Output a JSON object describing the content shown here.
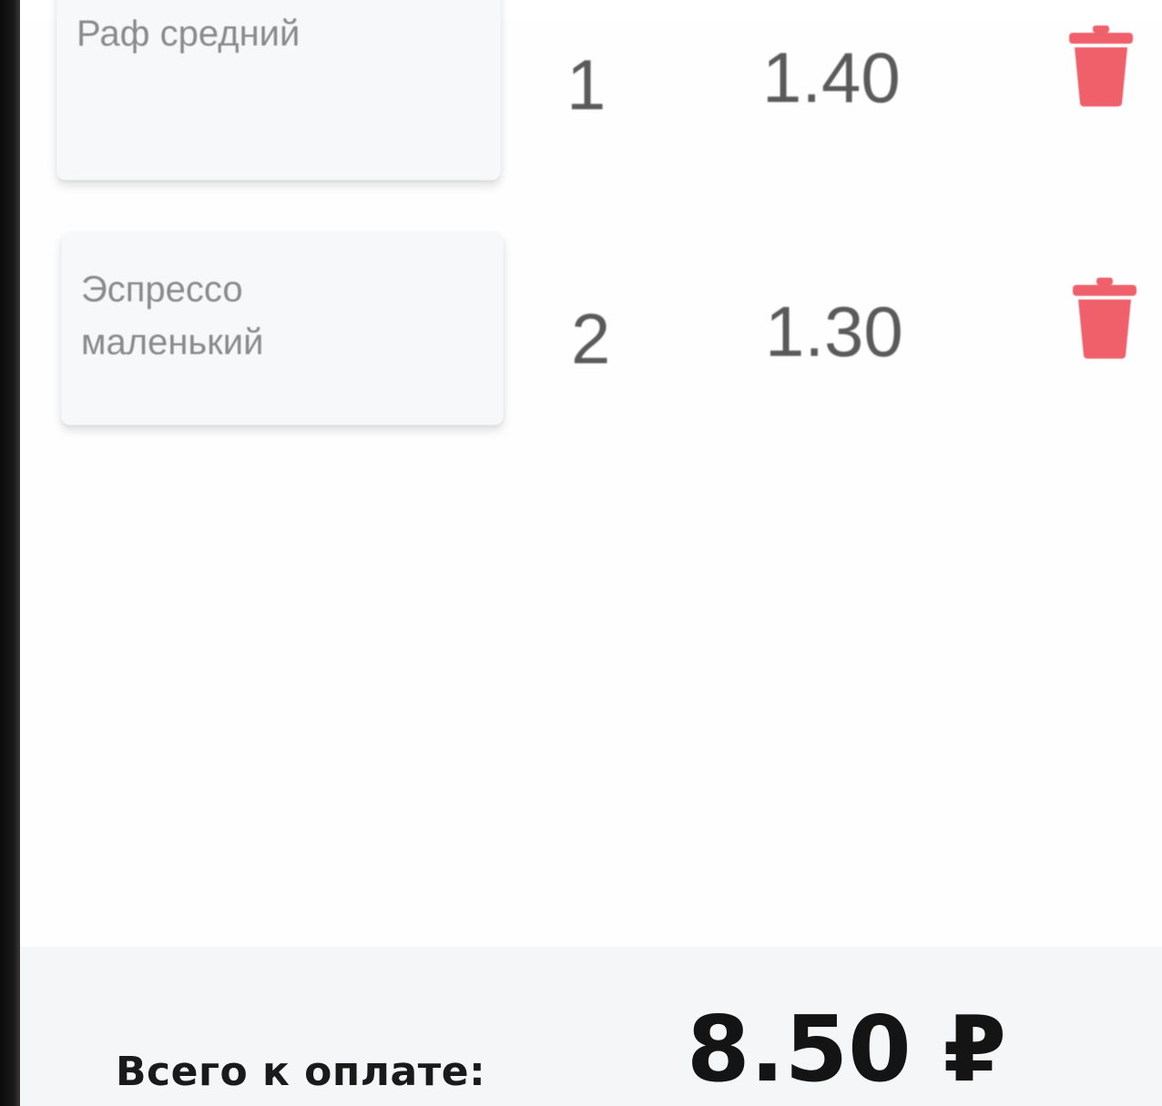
{
  "cart": {
    "items": [
      {
        "name": "Раф средний",
        "quantity": "1",
        "price": "1.40"
      },
      {
        "name": "Эспрессо маленький",
        "quantity": "2",
        "price": "1.30"
      }
    ]
  },
  "footer": {
    "total_label": "Всего к оплате:",
    "total_value": "8.50 ₽"
  },
  "icons": {
    "delete": "trash-icon"
  },
  "colors": {
    "delete_accent": "#f0606a",
    "card_bg": "#f7f8fa",
    "footer_bg": "#f4f6f8"
  }
}
